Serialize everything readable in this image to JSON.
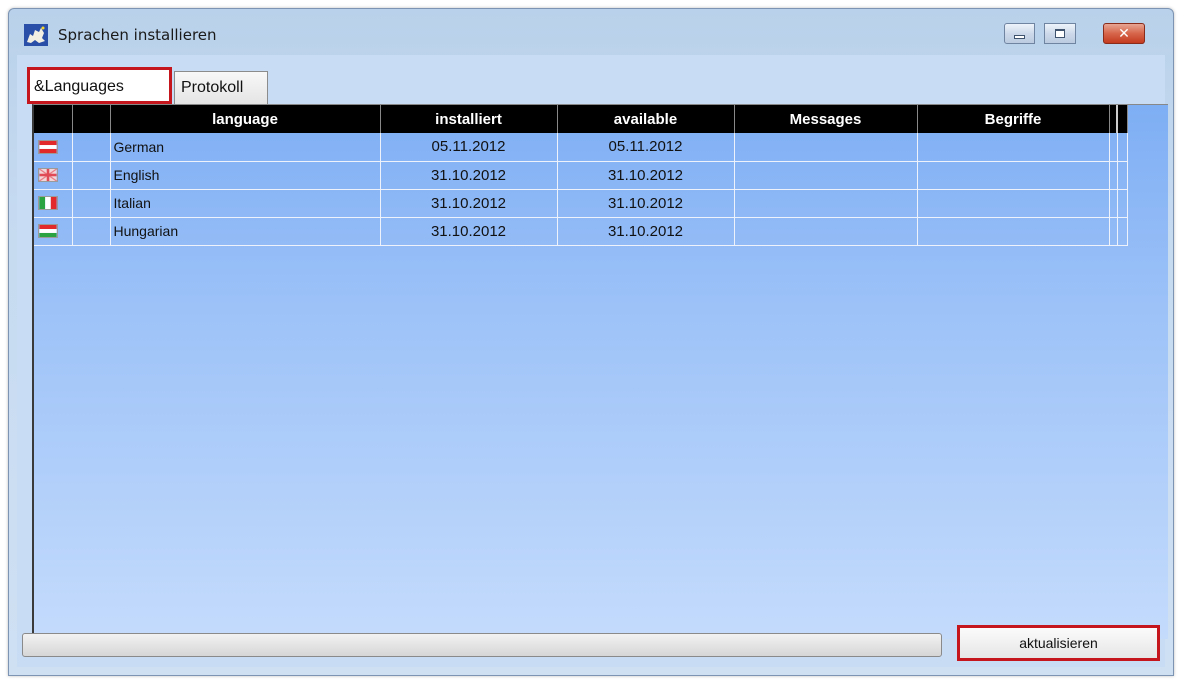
{
  "window": {
    "title": "Sprachen installieren",
    "app_icon": "europe-map-icon",
    "controls": [
      "minimize-icon",
      "maximize-icon",
      "close-icon"
    ]
  },
  "tabs": [
    {
      "label": "&Languages",
      "active": true
    },
    {
      "label": "Protokoll",
      "active": false
    }
  ],
  "table": {
    "columns": [
      "",
      "",
      "language",
      "installiert",
      "available",
      "Messages",
      "Begriffe",
      ""
    ],
    "rows": [
      {
        "flag": "austria-flag-icon",
        "language": "German",
        "installiert": "05.11.2012",
        "available": "05.11.2012",
        "messages": "",
        "begriffe": ""
      },
      {
        "flag": "uk-flag-icon",
        "language": "English",
        "installiert": "31.10.2012",
        "available": "31.10.2012",
        "messages": "",
        "begriffe": ""
      },
      {
        "flag": "italy-flag-icon",
        "language": "Italian",
        "installiert": "31.10.2012",
        "available": "31.10.2012",
        "messages": "",
        "begriffe": ""
      },
      {
        "flag": "hungary-flag-icon",
        "language": "Hungarian",
        "installiert": "31.10.2012",
        "available": "31.10.2012",
        "messages": "",
        "begriffe": ""
      }
    ]
  },
  "footer": {
    "progress": 0,
    "update_button": "aktualisieren"
  },
  "colors": {
    "highlight_border": "#c4161c",
    "header_bg": "#000000",
    "grid_bg": "#9ec3f8"
  }
}
